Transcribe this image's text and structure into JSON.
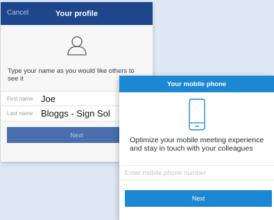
{
  "profile": {
    "cancel_label": "Cancel",
    "title": "Your profile",
    "instructions": "Type your name as you would like others to see it",
    "first_name_label": "First name",
    "first_name_value": "Joe",
    "last_name_label": "Last name",
    "last_name_value": "Bloggs - Sign Sol",
    "next_label": "Next",
    "avatar_icon": "person-outline-icon"
  },
  "phone": {
    "title": "Your mobile phone",
    "description": "Optimize your mobile meeting experience and stay in touch with your colleagues",
    "input_placeholder": "Enter mobile phone number",
    "input_value": "",
    "next_label": "Next",
    "phone_icon": "mobile-phone-icon"
  },
  "colors": {
    "profile_header": "#1d468c",
    "phone_header": "#1c87d2",
    "background": "#dfe8f5"
  }
}
